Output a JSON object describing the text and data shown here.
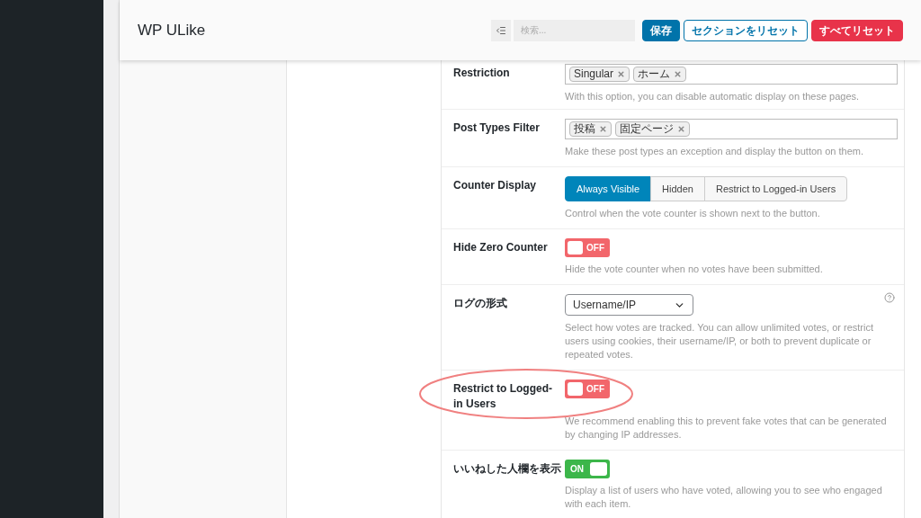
{
  "header": {
    "title": "WP ULike",
    "search": {
      "placeholder": "検索..."
    },
    "buttons": [
      {
        "label": "保存",
        "kind": "primary"
      },
      {
        "label": "セクションをリセット",
        "kind": "outline"
      },
      {
        "label": "すべてリセット",
        "kind": "danger"
      }
    ]
  },
  "fields": [
    {
      "kind": "tags",
      "label": "Restriction",
      "tags": [
        "Singular",
        "ホーム"
      ],
      "description": "With this option, you can disable automatic display on these pages.",
      "highlighted": false,
      "help": false
    },
    {
      "kind": "tags",
      "label": "Post Types Filter",
      "tags": [
        "投稿",
        "固定ページ"
      ],
      "description": "Make these post types an exception and display the button on them.",
      "highlighted": false,
      "help": false
    },
    {
      "kind": "segmented",
      "label": "Counter Display",
      "options": [
        {
          "label": "Always Visible",
          "selected": true
        },
        {
          "label": "Hidden",
          "selected": false
        },
        {
          "label": "Restrict to Logged-in Users",
          "selected": false
        }
      ],
      "description": "Control when the vote counter is shown next to the button.",
      "highlighted": false,
      "help": false
    },
    {
      "kind": "toggle",
      "label": "Hide Zero Counter",
      "on": false,
      "text": "OFF",
      "description": "Hide the vote counter when no votes have been submitted.",
      "highlighted": false,
      "help": false
    },
    {
      "kind": "select",
      "label": "ログの形式",
      "value": "Username/IP",
      "description": "Select how votes are tracked. You can allow unlimited votes, or restrict users using cookies, their username/IP, or both to prevent duplicate or repeated votes.",
      "highlighted": false,
      "help": true
    },
    {
      "kind": "toggle",
      "label": "Restrict to Logged-in Users",
      "on": false,
      "text": "OFF",
      "description": "We recommend enabling this to prevent fake votes that can be generated by changing IP addresses.",
      "highlighted": true,
      "help": false
    },
    {
      "kind": "toggle",
      "label": "いいねした人欄を表示",
      "on": true,
      "text": "ON",
      "description": "Display a list of users who have voted, allowing you to see who engaged with each item.",
      "highlighted": false,
      "help": false
    }
  ]
}
